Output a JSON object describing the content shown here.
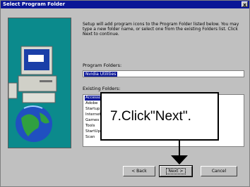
{
  "window": {
    "title": "Select Program Folder",
    "close_label": "x"
  },
  "intro_text": "Setup will add program icons to the Program Folder listed below. You may type a new folder name, or select one from the existing Folders list. Click Next to continue.",
  "program_folder": {
    "label": "Program Folders:",
    "value": "Nvidia Utilities"
  },
  "existing_folders": {
    "label": "Existing Folders:",
    "items": [
      "Accessories",
      "Adobe",
      "Startup",
      "Internet",
      "Games",
      "Tools",
      "StartUp",
      "Scan"
    ]
  },
  "annotation": {
    "text": "7.Click\"Next\"."
  },
  "buttons": {
    "back": "< Back",
    "next": "Next >",
    "cancel": "Cancel"
  }
}
